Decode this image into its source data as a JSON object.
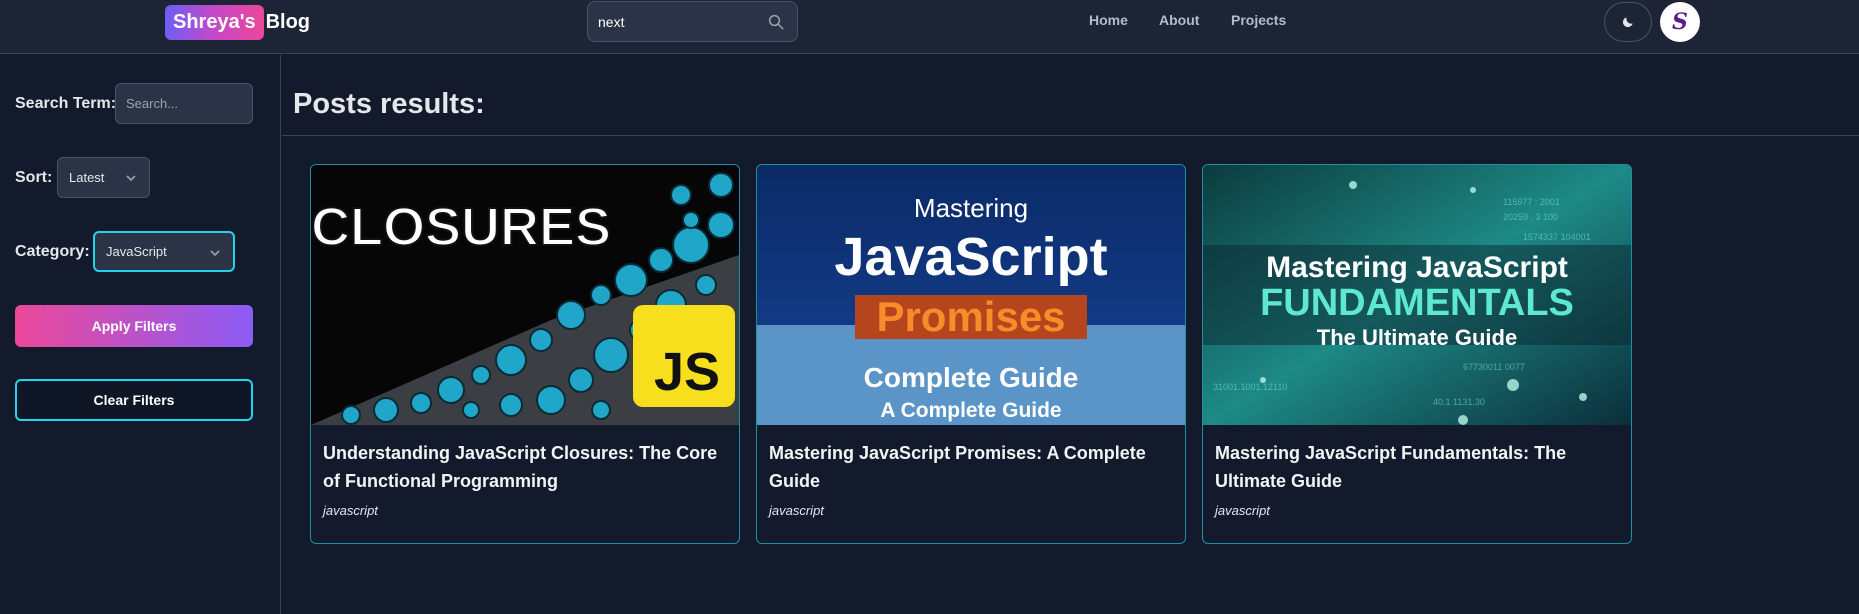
{
  "header": {
    "logo_badge": "Shreya's",
    "logo_text": "Blog",
    "search_value": "next",
    "nav": [
      "Home",
      "About",
      "Projects"
    ],
    "theme_icon": "moon-icon",
    "avatar_text": "S"
  },
  "sidebar": {
    "search_label": "Search Term:",
    "search_placeholder": "Search...",
    "sort_label": "Sort:",
    "sort_value": "Latest",
    "category_label": "Category:",
    "category_value": "JavaScript",
    "apply_label": "Apply Filters",
    "clear_label": "Clear Filters"
  },
  "main": {
    "title": "Posts results:",
    "posts": [
      {
        "title": "Understanding JavaScript Closures: The Core of Functional Programming",
        "category": "javascript",
        "image_text": [
          "CLOSURES",
          "JS"
        ]
      },
      {
        "title": "Mastering JavaScript Promises: A Complete Guide",
        "category": "javascript",
        "image_text": [
          "Mastering",
          "JavaScript",
          "Promises",
          "Complete Guide",
          "A Complete Guide"
        ]
      },
      {
        "title": "Mastering JavaScript Fundamentals: The Ultimate Guide",
        "category": "javascript",
        "image_text": [
          "Mastering JavaScript",
          "FUNDAMENTALS",
          "The Ultimate Guide"
        ]
      }
    ]
  },
  "colors": {
    "background": "#131a2c",
    "header": "#1c2435",
    "accent_cyan": "#22d3ee",
    "gradient_pink": "#ec4899",
    "gradient_purple": "#8b5cf6"
  }
}
